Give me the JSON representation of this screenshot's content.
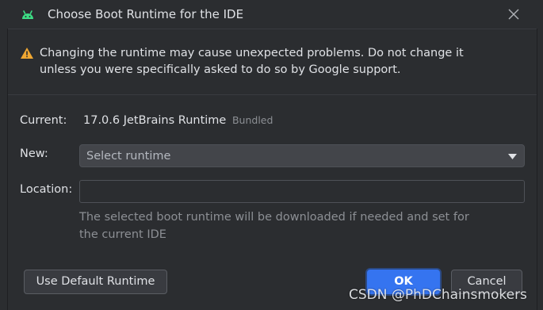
{
  "window": {
    "title": "Choose Boot Runtime for the IDE",
    "app_icon": "android-icon",
    "close_icon": "close-icon"
  },
  "warning": {
    "icon": "warning-icon",
    "text": "Changing the runtime may cause unexpected problems. Do not change it unless you were specifically asked to do so by Google support."
  },
  "form": {
    "current_label": "Current:",
    "current_value": "17.0.6 JetBrains Runtime",
    "current_badge": "Bundled",
    "new_label": "New:",
    "new_select_value": "Select runtime",
    "location_label": "Location:",
    "location_value": "",
    "hint": "The selected boot runtime will be downloaded if needed and set for the current IDE"
  },
  "buttons": {
    "use_default": "Use Default Runtime",
    "ok": "OK",
    "cancel": "Cancel"
  },
  "watermark": "CSDN @PhDChainsmokers",
  "colors": {
    "background": "#2b2d30",
    "accent": "#3574f0",
    "warning": "#f0a732",
    "android": "#3ddc84"
  }
}
